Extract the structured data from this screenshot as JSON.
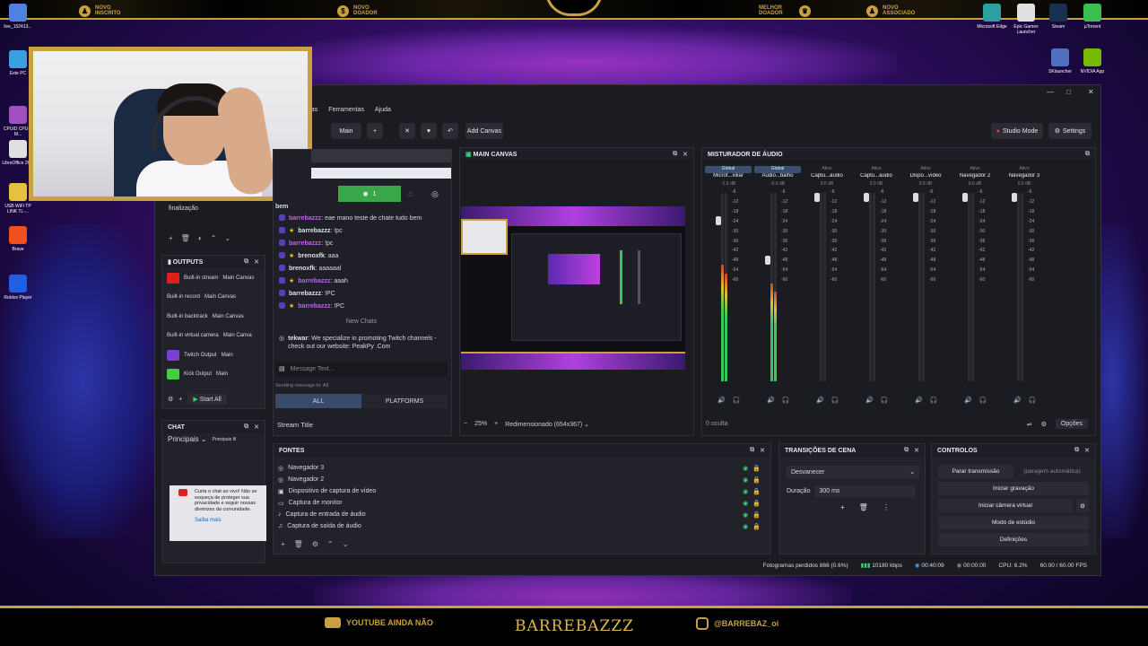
{
  "desktop": {
    "left_icons": [
      {
        "label": "live_152413...",
        "color": "#5080e0"
      },
      {
        "label": "Este PC",
        "color": "#3aa0e0"
      },
      {
        "label": "CPUID CPU-Z M...",
        "color": "#a050c0"
      },
      {
        "label": "LibreOffice 26.2",
        "color": "#e0e0e0"
      },
      {
        "label": "USB WiFi TP LINK TL-...",
        "color": "#e8c040"
      },
      {
        "label": "Brave",
        "color": "#f05020"
      },
      {
        "label": "Roblox Player",
        "color": "#2060e0"
      }
    ],
    "right_icons": [
      {
        "label": "Microsoft Edge",
        "color": "#2aa0a0"
      },
      {
        "label": "Epic Games Launcher",
        "color": "#e0e0e0"
      },
      {
        "label": "Steam",
        "color": "#1a3050"
      },
      {
        "label": "µTorrent",
        "color": "#3ac050"
      },
      {
        "label": "SKlauncher",
        "color": "#5070c0"
      },
      {
        "label": "NVIDIA App",
        "color": "#76b900"
      }
    ]
  },
  "overlay": {
    "top": {
      "novo_inscrito": "NOVO INSCRITO",
      "novo_doador": "NOVO DOADOR",
      "melhor_doador": "MELHOR DOADOR",
      "novo_associado": "NOVO ASSOCIADO"
    },
    "bottom": {
      "youtube": "YOUTUBE AINDA NÃO",
      "title": "BARREBAZZZ",
      "instagram": "@BARREBAZ_oi"
    }
  },
  "obs": {
    "menu": [
      "nas",
      "Ferramentas",
      "Ajuda"
    ],
    "toolbar": {
      "main_label": "Main",
      "plus": "+",
      "add_canvas": "Add Canvas",
      "studio_mode": "Studio Mode",
      "settings": "Settings"
    },
    "left_panel": {
      "finalizacao": "finalização"
    },
    "outputs": {
      "title": "OUTPUTS",
      "items": [
        {
          "name": "Built-in stream",
          "target": "Main Canvas"
        },
        {
          "name": "Built-in record",
          "target": "Main Canvas"
        },
        {
          "name": "Built-in backtrack",
          "target": "Main Canvas"
        },
        {
          "name": "Built-in virtual camera",
          "target": "Main Canva"
        },
        {
          "name": "Twitch Output",
          "target": "Main"
        },
        {
          "name": "Kick Output",
          "target": "Main"
        }
      ],
      "start_all": "Start All"
    },
    "chat_dock": {
      "title": "CHAT",
      "selector": "Principais",
      "principais": "Principais fil",
      "notice": "Curta o chat ao vivo! Não se esqueça de proteger sua privacidade e seguir nossas diretrizes da comunidade.",
      "saiba_mais": "Saiba mais"
    },
    "chat": {
      "viewers": "1",
      "partial_top": "bem",
      "messages": [
        {
          "user": "barrebazzz",
          "text": ": eae mano teste de chate tudo bem",
          "style": "purple"
        },
        {
          "user": "barrebazzz",
          "text": ": !pc",
          "style": "white"
        },
        {
          "user": "barrebazzz",
          "text": ": !pc",
          "style": "purple"
        },
        {
          "user": "brenoxfk",
          "text": ": aaa",
          "style": "white"
        },
        {
          "user": "brenoxfk",
          "text": ": aaaaaal",
          "style": "white"
        },
        {
          "user": "barrebazzz",
          "text": ": aaah",
          "style": "purple"
        },
        {
          "user": "barrebazzz",
          "text": ": !PC",
          "style": "white"
        },
        {
          "user": "barrebazzz",
          "text": ": !PC",
          "style": "purple"
        }
      ],
      "new_chats": "New Chats",
      "spam_user": "tekwar",
      "spam_text": ": We specialize in promoting Twitch channels - check out our website: PeakPy .Com",
      "placeholder": "Message Text...",
      "sending_to": "Sending message to: All",
      "tab_all": "ALL",
      "tab_platforms": "PLATFORMS",
      "stream_title": "Stream Title"
    },
    "main_canvas": {
      "title": "MAIN CANVAS",
      "zoom": "25%",
      "resize": "Redimensionado (654x367)"
    },
    "mixer": {
      "title": "MISTURADOR DE ÁUDIO",
      "channels": [
        {
          "name": "Microf...xiliar",
          "tag": "Global",
          "db": "-2.5 dB",
          "level": 0.62
        },
        {
          "name": "Áudio...balho",
          "tag": "Global",
          "db": "-6.0 dB",
          "level": 0.52
        },
        {
          "name": "Captu...áudio",
          "tag": "Ativo",
          "db": "0.0 dB",
          "level": 0
        },
        {
          "name": "Captu...áudio",
          "tag": "Ativo",
          "db": "0.0 dB",
          "level": 0
        },
        {
          "name": "Dispo...vídeo",
          "tag": "Ativo",
          "db": "0.0 dB",
          "level": 0
        },
        {
          "name": "Navegador 2",
          "tag": "Ativo",
          "db": "0.0 dB",
          "level": 0
        },
        {
          "name": "Navegador 3",
          "tag": "Ativo",
          "db": "0.0 dB",
          "level": 0
        }
      ],
      "scale": [
        "-6",
        "-12",
        "-18",
        "-24",
        "-30",
        "-36",
        "-42",
        "-48",
        "-54",
        "-60"
      ],
      "hidden": "0 oculta",
      "options": "Opções"
    },
    "sources": {
      "title": "FONTES",
      "items": [
        "Navegador 3",
        "Navegador 2",
        "Dispositivo de captura de vídeo",
        "Captura de monitor",
        "Captura de entrada de áudio",
        "Captura de saída de áudio"
      ]
    },
    "transitions": {
      "title": "TRANSIÇÕES DE CENA",
      "selected": "Desvanecer",
      "duration_label": "Duração",
      "duration_value": "300 ms"
    },
    "controls": {
      "title": "CONTROLOS",
      "stop_stream": "Parar transmissão",
      "auto_stop": "(paragem automática)",
      "start_record": "Iniciar gravação",
      "virtual_cam": "Iniciar câmera virtual",
      "studio_mode": "Modo de estúdio",
      "settings": "Definições"
    },
    "status": {
      "dropped": "Fotogramas perdidos 866 (0.6%)",
      "bitrate": "10180 kbps",
      "stream_time": "00:40:09",
      "rec_time": "00:00:00",
      "cpu": "CPU: 6.2%",
      "fps": "60.00 / 60.00 FPS"
    }
  },
  "colors": {
    "gold": "#c8a040",
    "live_green": "#3aa84a",
    "meter_green": "#37c85a",
    "meter_yellow": "#e0c030",
    "meter_red": "#d04030"
  }
}
